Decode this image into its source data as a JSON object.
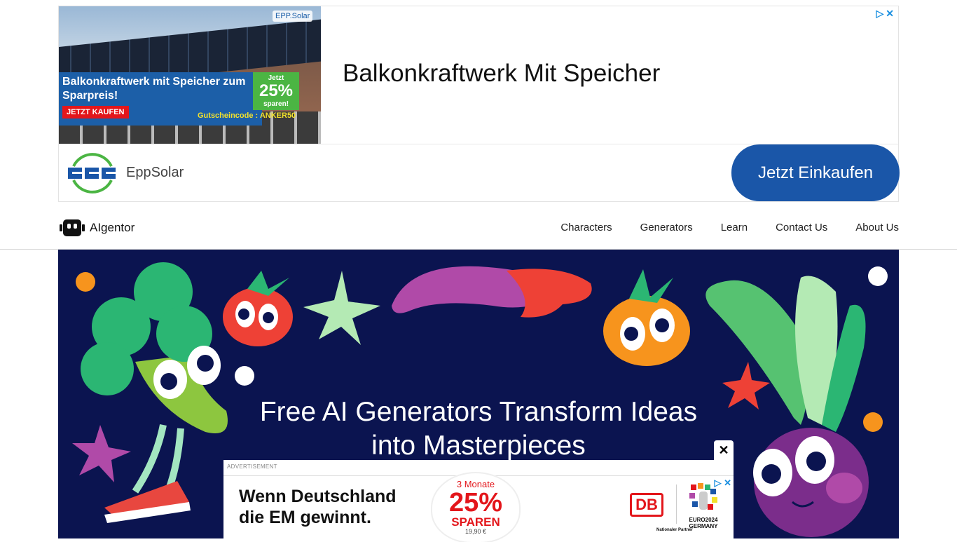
{
  "top_ad": {
    "image_brand": "EPP.Solar",
    "image_headline": "Balkonkraftwerk mit Speicher zum Sparpreis!",
    "image_buy_label": "JETZT KAUFEN",
    "image_pct_top": "Jetzt",
    "image_pct_value": "25%",
    "image_pct_bottom": "sparen!",
    "image_code": "Gutscheincode : ANKER50",
    "title": "Balkonkraftwerk Mit Speicher",
    "brand_name": "EppSolar",
    "cta_label": "Jetzt Einkaufen",
    "choices_icons": [
      "ad-choices-icon",
      "close-icon"
    ]
  },
  "nav": {
    "logo_text": "AIgentor",
    "links": [
      "Characters",
      "Generators",
      "Learn",
      "Contact Us",
      "About Us"
    ]
  },
  "hero": {
    "title_line1": "Free AI Generators Transform Ideas",
    "title_line2": "into Masterpieces",
    "background": "#0b1450"
  },
  "bottom_ad": {
    "close_label": "✕",
    "label": "ADVERTISEMENT",
    "headline_line1": "Wenn Deutschland",
    "headline_line2": "die EM gewinnt.",
    "sale_months": "3 Monate",
    "sale_value": "25%",
    "sale_word": "SPAREN",
    "sale_price": "19,90 €",
    "db_logo": "DB",
    "euro_text": "EURO2024",
    "euro_country": "GERMANY",
    "partner_text": "Nationaler Partner"
  }
}
